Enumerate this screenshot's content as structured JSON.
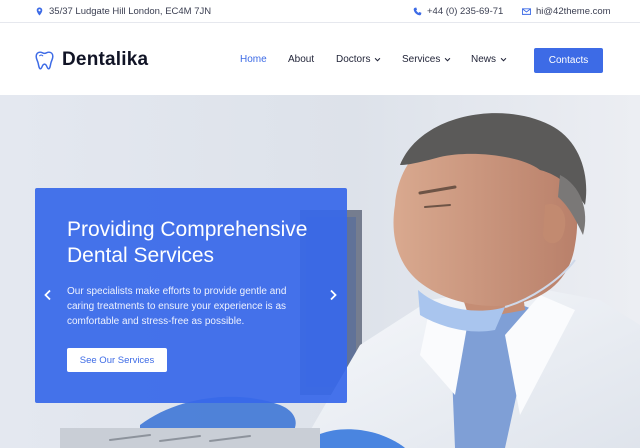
{
  "topbar": {
    "address": "35/37 Ludgate Hill London, EC4M 7JN",
    "phone": "+44 (0) 235-69-71",
    "email": "hi@42theme.com"
  },
  "header": {
    "logo_text": "Dentalika",
    "nav": {
      "home": "Home",
      "about": "About",
      "doctors": "Doctors",
      "services": "Services",
      "news": "News"
    },
    "contacts_label": "Contacts"
  },
  "hero": {
    "title": "Providing Comprehensive Dental Services",
    "text": "Our specialists make efforts to provide gentle and caring treatments to ensure your experience is as comfortable and stress-free as possible.",
    "button_label": "See Our Services"
  },
  "colors": {
    "accent": "#3d6be6",
    "card": "#3868ea",
    "text_dark": "#1a1a2e"
  },
  "icons": {
    "address": "map-pin-icon",
    "phone": "phone-icon",
    "email": "envelope-icon",
    "logo": "tooth-icon",
    "dropdown": "chevron-down-icon",
    "prev": "chevron-left-icon",
    "next": "chevron-right-icon"
  }
}
